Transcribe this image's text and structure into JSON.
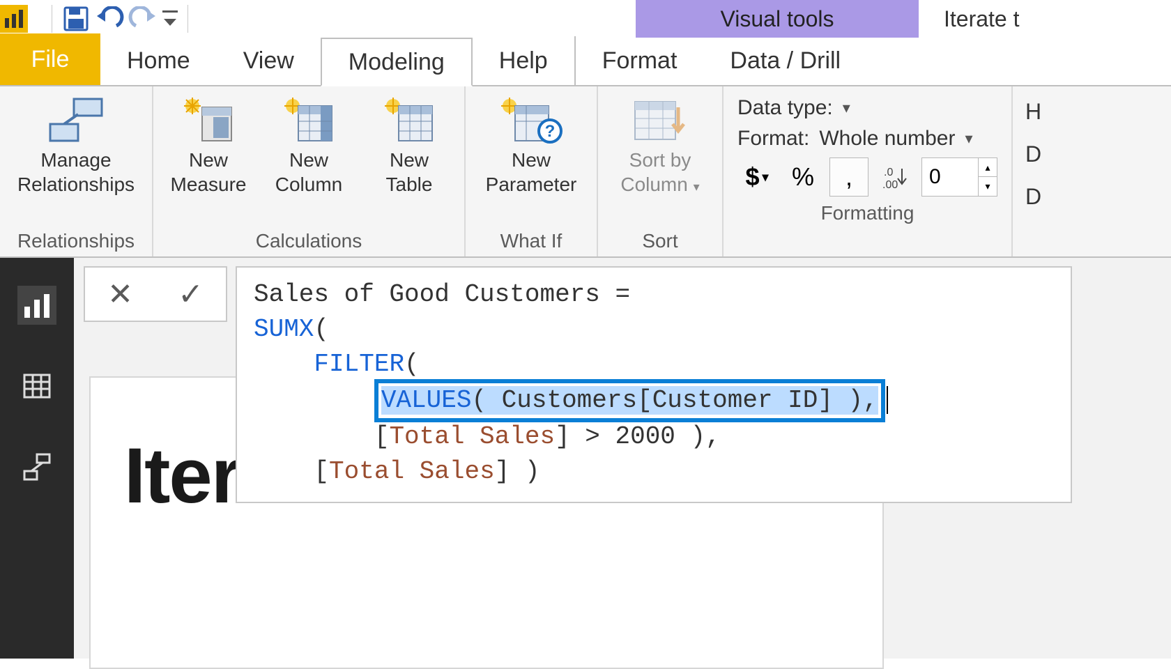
{
  "qat": {
    "visual_tools": "Visual tools",
    "doc_title": "Iterate t"
  },
  "tabs": {
    "file": "File",
    "items": [
      "Home",
      "View",
      "Modeling",
      "Help",
      "Format",
      "Data / Drill"
    ],
    "active_index": 2
  },
  "ribbon": {
    "relationships": {
      "btn": "Manage\nRelationships",
      "label": "Relationships"
    },
    "calculations": {
      "new_measure": "New\nMeasure",
      "new_column": "New\nColumn",
      "new_table": "New\nTable",
      "label": "Calculations"
    },
    "whatif": {
      "btn": "New\nParameter",
      "label": "What If"
    },
    "sort": {
      "btn": "Sort by\nColumn",
      "label": "Sort"
    },
    "formatting": {
      "datatype_label": "Data type:",
      "format_label": "Format:",
      "format_value": "Whole number",
      "decimals": "0",
      "label": "Formatting"
    },
    "right_stub": [
      "H",
      "D",
      "D"
    ]
  },
  "formula": {
    "line1_plain": "Sales of Good Customers = ",
    "sumx": "SUMX",
    "filter": "FILTER",
    "values": "VALUES",
    "values_arg": "( Customers[Customer ID] ),",
    "total_sales": "Total Sales",
    "cmp": " > 2000 ),",
    "close": " )"
  },
  "bg_card": {
    "title": "Iter"
  }
}
